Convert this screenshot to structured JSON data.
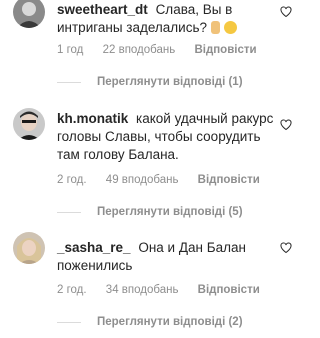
{
  "comments": [
    {
      "username": "sweetheart_dt",
      "text": "Слава, Вы в интриганы заделались?",
      "emoji": [
        "🤷",
        "😂"
      ],
      "time": "1 год",
      "likes": "22 вподобань",
      "reply_label": "Відповісти",
      "view_replies": "Переглянути відповіді (1)"
    },
    {
      "username": "kh.monatik",
      "text": "какой удачный ракурс головы Славы, чтобы соорудить там голову Балана.",
      "time": "2 год.",
      "likes": "49 вподобань",
      "reply_label": "Відповісти",
      "view_replies": "Переглянути відповіді (5)"
    },
    {
      "username": "_sasha_re_",
      "text": "Она и Дан Балан поженились",
      "time": "2 год.",
      "likes": "34 вподобань",
      "reply_label": "Відповісти",
      "view_replies": "Переглянути відповіді (2)"
    }
  ],
  "icons": {
    "like": "heart-outline-icon"
  },
  "colors": {
    "text": "#262626",
    "secondary": "#8e8e8e",
    "divider": "#dbdbdb"
  }
}
